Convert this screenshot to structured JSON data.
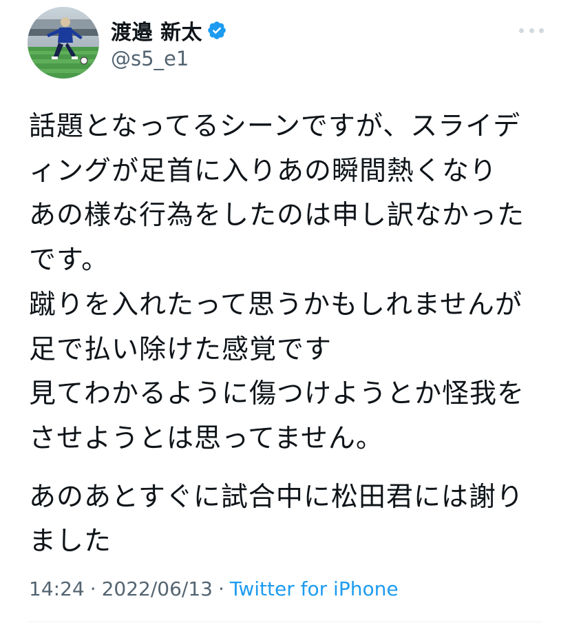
{
  "author": {
    "display_name": "渡邉 新太",
    "handle": "@s5_e1",
    "verified": true
  },
  "tweet": {
    "lines_p1": [
      "話題となってるシーンですが、スライデ",
      "ィングが足首に入りあの瞬間熱くなり",
      "あの様な行為をしたのは申し訳なかった",
      "です。",
      "蹴りを入れたって思うかもしれませんが",
      "足で払い除けた感覚です",
      "見てわかるように傷つけようとか怪我を",
      "させようとは思ってません。"
    ],
    "lines_p2": [
      "あのあとすぐに試合中に松田君には謝り",
      "ました"
    ]
  },
  "meta": {
    "time": "14:24",
    "date": "2022/06/13",
    "separator": "·",
    "source": "Twitter for iPhone"
  },
  "icons": {
    "verified": "verified-badge-icon",
    "more": "more-options-icon"
  },
  "colors": {
    "accent": "#1d9bf0",
    "secondary_text": "#536471",
    "primary_text": "#0f1419"
  }
}
